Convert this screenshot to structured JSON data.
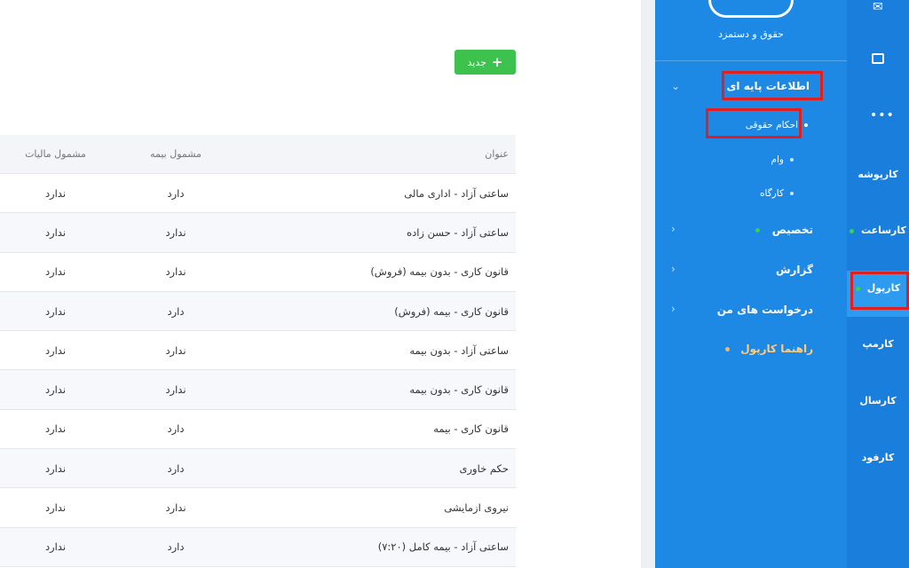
{
  "toolbar": {
    "new_label": "جدید"
  },
  "table": {
    "headers": {
      "title": "عنوان",
      "insurance": "مشمول بیمه",
      "tax": "مشمول مالیات"
    },
    "rows": [
      {
        "title": "ساعتی آزاد - اداری مالی",
        "insurance": "دارد",
        "tax": "ندارد"
      },
      {
        "title": "ساعتی آزاد - حسن زاده",
        "insurance": "ندارد",
        "tax": "ندارد"
      },
      {
        "title": "قانون کاری - بدون بیمه (فروش)",
        "insurance": "ندارد",
        "tax": "ندارد"
      },
      {
        "title": "قانون کاری - بیمه (فروش)",
        "insurance": "دارد",
        "tax": "ندارد"
      },
      {
        "title": "ساعتی آزاد - بدون بیمه",
        "insurance": "ندارد",
        "tax": "ندارد"
      },
      {
        "title": "قانون کاری - بدون بیمه",
        "insurance": "ندارد",
        "tax": "ندارد"
      },
      {
        "title": "قانون کاری - بیمه",
        "insurance": "دارد",
        "tax": "ندارد"
      },
      {
        "title": "حکم خاوری",
        "insurance": "دارد",
        "tax": "ندارد"
      },
      {
        "title": "نیروی ازمایشی",
        "insurance": "ندارد",
        "tax": "ندارد"
      },
      {
        "title": "ساعتی آزاد - بیمه کامل (۷:۲۰)",
        "insurance": "دارد",
        "tax": "ندارد"
      }
    ]
  },
  "sidebar": {
    "app_title": "حقوق و دستمزد",
    "base_info": "اطلاعات پایه ای",
    "sub_items": [
      "احکام حقوقی",
      "وام",
      "کارگاه"
    ],
    "allocation": "تخصیص",
    "report": "گزارش",
    "my_requests": "درخواست های من",
    "guide": "راهنما کارپول"
  },
  "rail": {
    "items": [
      "کارپوشه",
      "کارساعت",
      "کارپول",
      "کارمپ",
      "کارسال",
      "کارفود"
    ]
  },
  "colors": {
    "primary": "#1e88e5",
    "rail": "#1a7fdc",
    "success": "#3cc24d",
    "highlight": "#e02020"
  }
}
